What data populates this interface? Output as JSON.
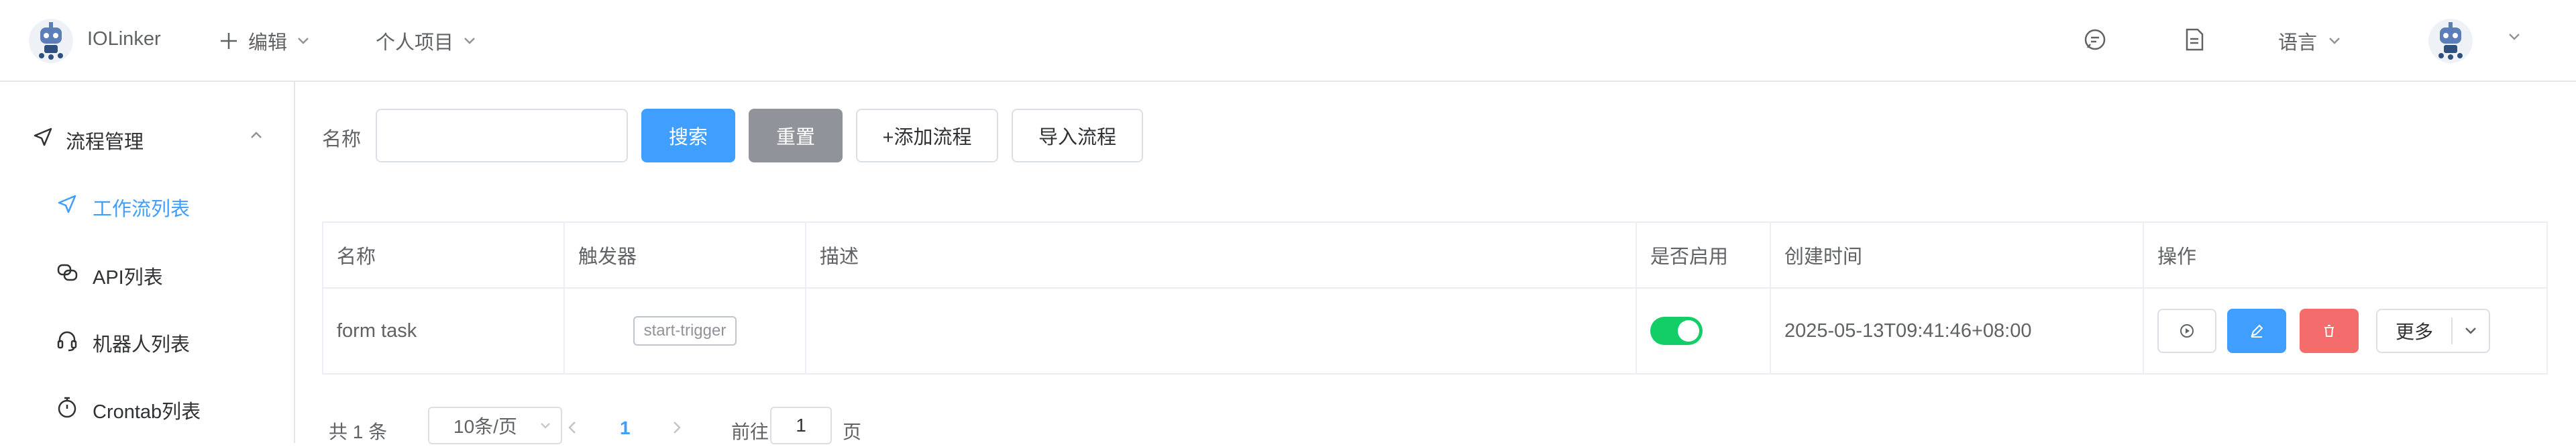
{
  "header": {
    "app_name": "IOLinker",
    "menu_edit": "编辑",
    "menu_project": "个人项目",
    "language": "语言"
  },
  "sidebar": {
    "group_label": "流程管理",
    "items": [
      {
        "label": "工作流列表",
        "icon": "send-icon",
        "active": true
      },
      {
        "label": "API列表",
        "icon": "api-icon",
        "active": false
      },
      {
        "label": "机器人列表",
        "icon": "headset-icon",
        "active": false
      },
      {
        "label": "Crontab列表",
        "icon": "timer-icon",
        "active": false
      }
    ]
  },
  "search": {
    "label": "名称",
    "value": "",
    "search_button": "搜索",
    "reset_button": "重置",
    "add_button": "+添加流程",
    "import_button": "导入流程"
  },
  "table": {
    "headers": [
      "名称",
      "触发器",
      "描述",
      "是否启用",
      "创建时间",
      "操作"
    ],
    "rows": [
      {
        "name": "form task",
        "trigger": "start-trigger",
        "description": "",
        "enabled": true,
        "created": "2025-05-13T09:41:46+08:00",
        "more": "更多"
      }
    ]
  },
  "pagination": {
    "total": "共 1 条",
    "page_size": "10条/页",
    "current_page": "1",
    "goto_label": "前往",
    "goto_value": "1",
    "page_suffix": "页"
  },
  "colors": {
    "primary": "#409eff",
    "success": "#13ce66",
    "danger": "#f56c6c",
    "gray": "#909399"
  }
}
